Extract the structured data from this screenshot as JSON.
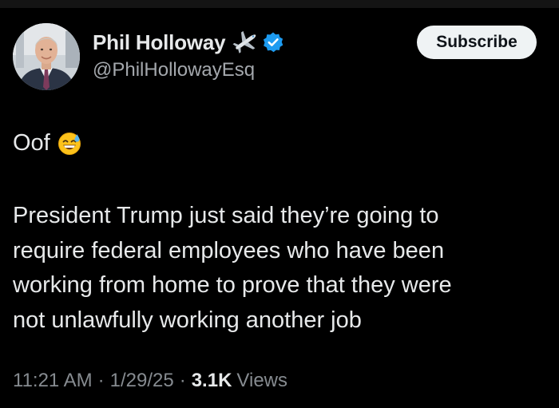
{
  "author": {
    "display_name": "Phil Holloway",
    "handle": "@PhilHollowayEsq",
    "avatar": "profile-photo-man-in-suit",
    "badges": [
      "airplane-emoji",
      "verified-badge"
    ]
  },
  "subscribe_label": "Subscribe",
  "tweet": {
    "intro": "Oof",
    "intro_emoji": "grinning-face-with-sweat-emoji",
    "lines": [
      "President Trump just said they’re going to",
      "require federal employees who have been",
      "working from home to prove that they were",
      "not unlawfully working another job"
    ]
  },
  "meta": {
    "time": "11:21 AM",
    "separator": "·",
    "date": "1/29/25",
    "views_count": "3.1K",
    "views_label": "Views"
  },
  "colors": {
    "background": "#000000",
    "text_primary": "#e7e9ea",
    "text_secondary": "#868b90",
    "verified": "#1d9bf0",
    "button_bg": "#eff3f4",
    "button_text": "#0f1419"
  }
}
